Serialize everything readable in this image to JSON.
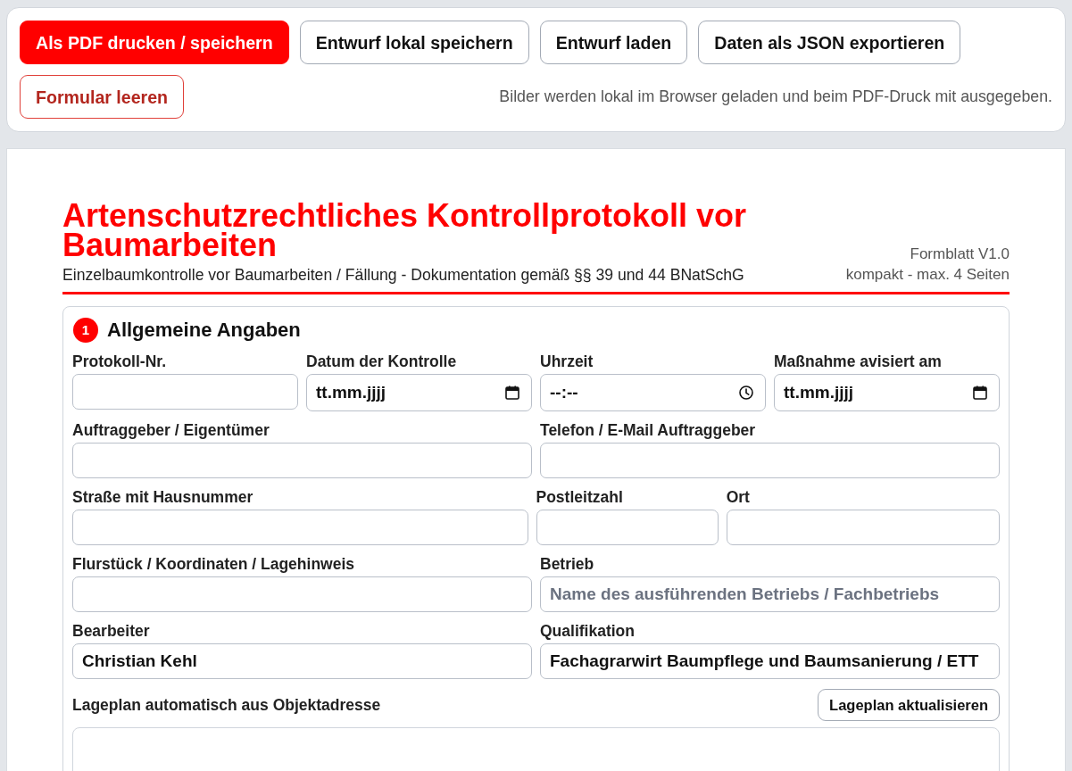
{
  "toolbar": {
    "buttons": [
      {
        "label": "Als PDF drucken / speichern",
        "kind": "primary"
      },
      {
        "label": "Entwurf lokal speichern",
        "kind": "secondary"
      },
      {
        "label": "Entwurf laden",
        "kind": "secondary"
      },
      {
        "label": "Daten als JSON exportieren",
        "kind": "secondary"
      },
      {
        "label": "Formular leeren",
        "kind": "danger"
      }
    ],
    "note": "Bilder werden lokal im Browser geladen und beim PDF-Druck mit ausgegeben."
  },
  "header": {
    "title": "Artenschutzrechtliches Kontrollprotokoll vor Baumarbeiten",
    "subtitle": "Einzelbaumkontrolle vor Baumarbeiten / Fällung - Dokumentation gemäß §§ 39 und 44 BNatSchG",
    "form_version": "Formblatt V1.0",
    "page_limit": "kompakt - max. 4 Seiten"
  },
  "sections": [
    {
      "number": "1",
      "title": "Allgemeine Angaben",
      "field_groups": [
        {
          "fields": [
            {
              "label": "Protokoll-Nr.",
              "kind": "text"
            },
            {
              "label": "Datum der Kontrolle",
              "kind": "date",
              "placeholder": "tt.mm.jjjj"
            },
            {
              "label": "Uhrzeit",
              "kind": "time",
              "placeholder": "--:--"
            },
            {
              "label": "Maßnahme avisiert am",
              "kind": "date",
              "placeholder": "tt.mm.jjjj"
            }
          ]
        },
        {
          "fields": [
            {
              "label": "Auftraggeber / Eigentümer",
              "kind": "text"
            },
            {
              "label": "Telefon / E-Mail Auftraggeber",
              "kind": "text"
            }
          ]
        },
        {
          "fields": [
            {
              "label": "Straße mit Hausnummer",
              "kind": "text"
            },
            {
              "label": "Postleitzahl",
              "kind": "text"
            },
            {
              "label": "Ort",
              "kind": "text"
            }
          ]
        },
        {
          "fields": [
            {
              "label": "Flurstück / Koordinaten / Lagehinweis",
              "kind": "text"
            },
            {
              "label": "Betrieb",
              "kind": "text",
              "placeholder": "Name des ausführenden Betriebs / Fachbetriebs"
            }
          ]
        },
        {
          "fields": [
            {
              "label": "Bearbeiter",
              "kind": "text",
              "value": "Christian Kehl"
            },
            {
              "label": "Qualifikation",
              "kind": "text",
              "value": "Fachagrarwirt Baumpflege und Baumsanierung / ETT"
            }
          ]
        }
      ],
      "site_plan": {
        "label": "Lageplan automatisch aus Objektadresse",
        "button": "Lageplan aktualisieren"
      }
    }
  ]
}
